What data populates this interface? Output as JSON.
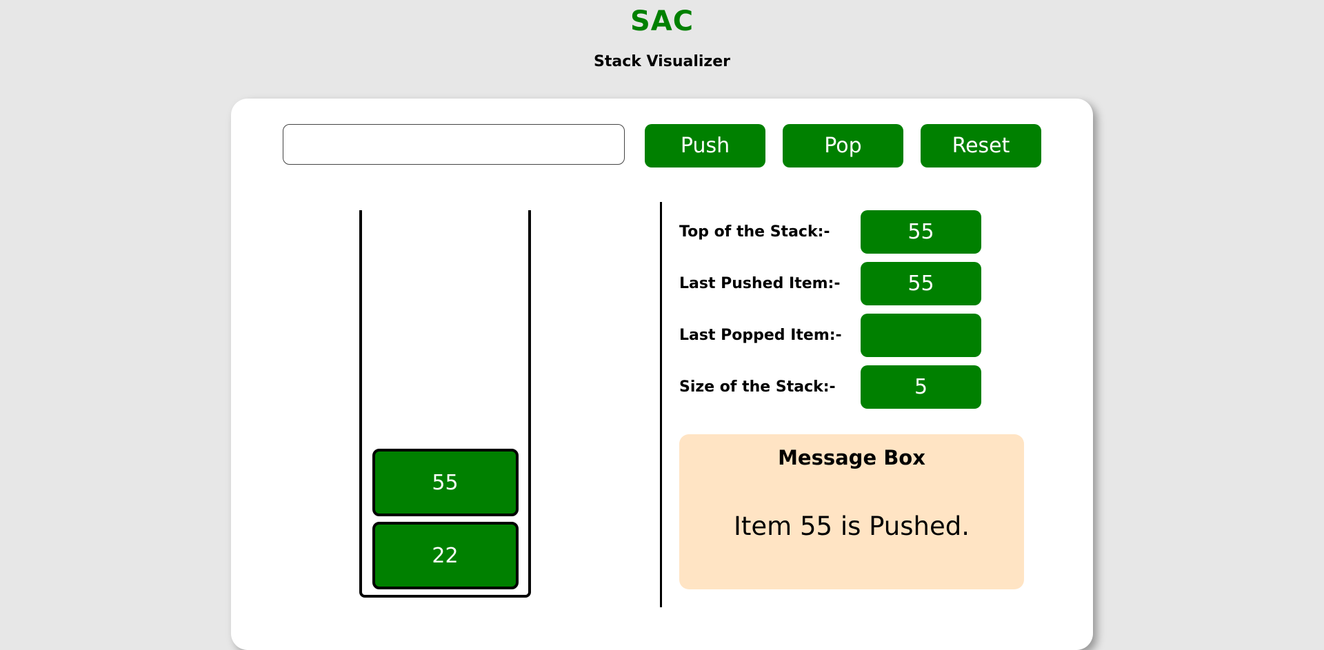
{
  "header": {
    "brand": "SAC",
    "subtitle": "Stack Visualizer"
  },
  "controls": {
    "input_value": "",
    "input_placeholder": "",
    "push_label": "Push",
    "pop_label": "Pop",
    "reset_label": "Reset"
  },
  "stack": {
    "items": [
      "55",
      "22"
    ]
  },
  "info": {
    "top_label": "Top of the Stack:-",
    "top_value": "55",
    "pushed_label": "Last Pushed Item:-",
    "pushed_value": "55",
    "popped_label": "Last Popped Item:-",
    "popped_value": "",
    "size_label": "Size of the Stack:-",
    "size_value": "5"
  },
  "message": {
    "title": "Message Box",
    "text": "Item 55 is Pushed."
  },
  "colors": {
    "accent": "#008000",
    "background": "#e7e7e7",
    "message_bg": "#ffe4c4"
  }
}
